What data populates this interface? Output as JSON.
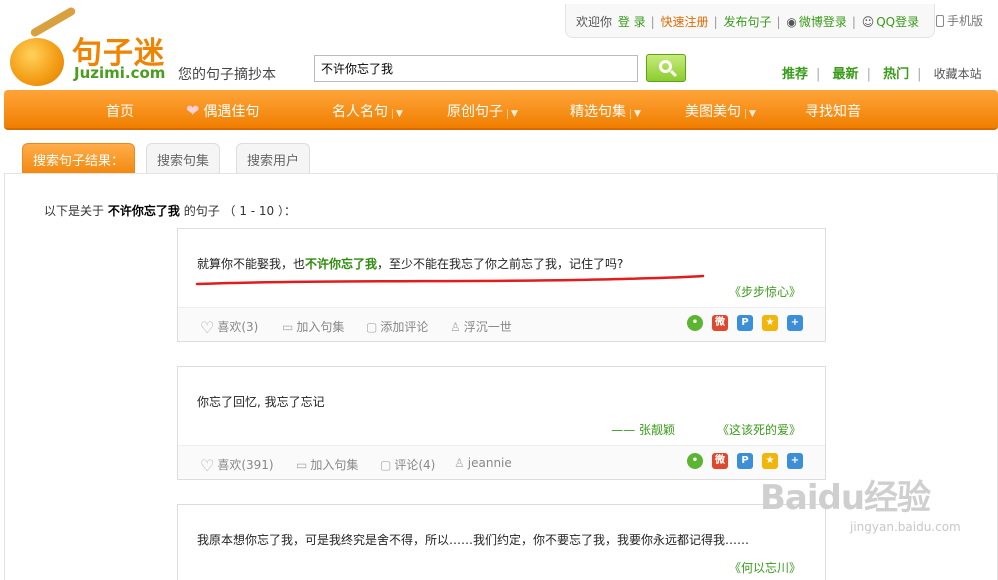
{
  "topbar": {
    "welcome": "欢迎你",
    "login": "登 录",
    "register": "快速注册",
    "publish": "发布句子",
    "weibo_login": "微博登录",
    "qq_login": "QQ登录",
    "mobile": "手机版"
  },
  "logo": {
    "cn": "句子迷",
    "en": "Juzimi.com",
    "slogan": "您的句子摘抄本"
  },
  "search": {
    "value": "不许你忘了我"
  },
  "right_links": {
    "recommend": "推荐",
    "latest": "最新",
    "hot": "热门",
    "bookmark": "收藏本站"
  },
  "nav": [
    {
      "label": "首页"
    },
    {
      "label": "偶遇佳句"
    },
    {
      "label": "名人名句"
    },
    {
      "label": "原创句子"
    },
    {
      "label": "精选句集"
    },
    {
      "label": "美图美句"
    },
    {
      "label": "寻找知音"
    }
  ],
  "tabs": [
    "搜索句子结果：",
    "搜索句集",
    "搜索用户"
  ],
  "result_head": {
    "prefix": "以下是关于",
    "keyword": "不许你忘了我",
    "suffix": "的句子 （ 1 - 10 ）："
  },
  "cards": [
    {
      "text_before": "就算你不能娶我，也",
      "text_hl": "不许你忘了我",
      "text_after": "，至少不能在我忘了你之前忘了我，记住了吗?",
      "source": "《步步惊心》",
      "like": "喜欢(3)",
      "add": "加入句集",
      "comment": "添加评论",
      "user": "浮沉一世"
    },
    {
      "text": "你忘了回忆, 我忘了忘记",
      "author": "—— 张靓颖",
      "source": "《这该死的爱》",
      "like": "喜欢(391)",
      "add": "加入句集",
      "comment": "评论(4)",
      "user": "jeannie"
    },
    {
      "text": "我原本想你忘了我，可是我终究是舍不得，所以……我们约定，你不要忘了我，我要你永远都记得我……",
      "source": "《何以忘川》"
    }
  ],
  "watermark": {
    "brand": "Baidu经验",
    "url": "jingyan.baidu.com"
  }
}
